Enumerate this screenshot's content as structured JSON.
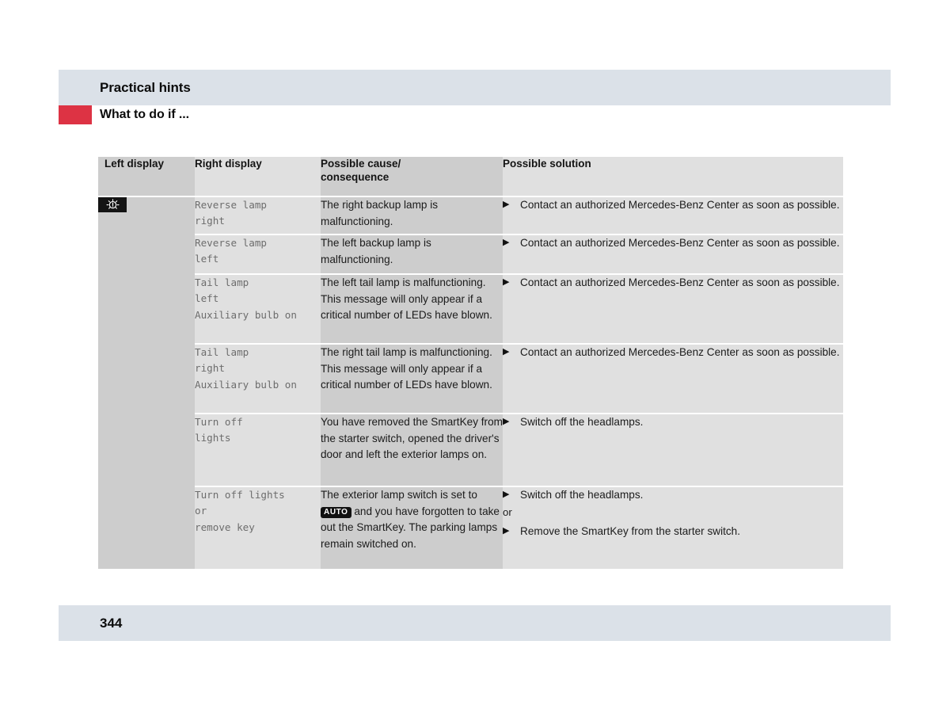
{
  "header": {
    "title": "Practical hints",
    "subheading": "What to do if ...",
    "marker_color": "#dd3344",
    "band_color": "#dbe1e8"
  },
  "table": {
    "columns": [
      "Left display",
      "Right display",
      "Possible cause/\nconsequence",
      "Possible solution"
    ],
    "left_display_icon": "lamp-warning-indicator-icon",
    "rows": [
      {
        "right_display": "Reverse lamp\nright",
        "cause": "The right backup lamp is malfunctioning.",
        "solutions": [
          "Contact an authorized Mercedes-Benz Center as soon as possible."
        ]
      },
      {
        "right_display": "Reverse lamp\nleft",
        "cause": "The left backup lamp is malfunctioning.",
        "solutions": [
          "Contact an authorized Mercedes-Benz Center as soon as possible."
        ]
      },
      {
        "right_display": "Tail lamp\nleft\nAuxiliary bulb on",
        "cause": "The left tail lamp is malfunctioning. This message will only appear if a critical number of LEDs have blown.",
        "solutions": [
          "Contact an authorized Mercedes-Benz Center as soon as possible."
        ]
      },
      {
        "right_display": "Tail lamp\nright\nAuxiliary bulb on",
        "cause": "The right tail lamp is malfunctioning. This message will only appear if a critical number of LEDs have blown.",
        "solutions": [
          "Contact an authorized Mercedes-Benz Center as soon as possible."
        ]
      },
      {
        "right_display": "Turn off\nlights",
        "cause": "You have removed the SmartKey from the starter switch, opened the driver's door and left the exterior lamps on.",
        "solutions": [
          "Switch off the headlamps."
        ]
      },
      {
        "right_display": "Turn off lights\nor\nremove key",
        "cause_parts": [
          "The exterior lamp switch is set to ",
          "AUTO",
          " and you have forgotten to take out the SmartKey. The parking lamps remain switched on."
        ],
        "solutions": [
          "Switch off the headlamps.",
          "Remove the SmartKey from the starter switch."
        ],
        "solution_separator": "or"
      }
    ],
    "bullet_glyph": "▶"
  },
  "footer": {
    "page_number": "344"
  }
}
